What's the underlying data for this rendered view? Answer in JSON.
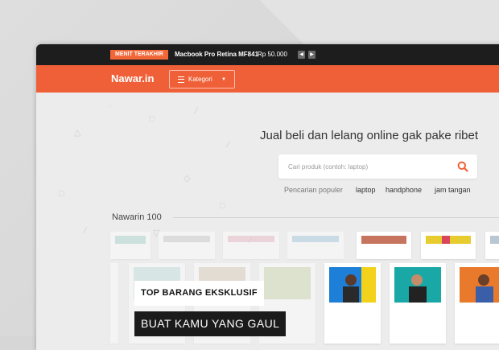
{
  "ticker": {
    "badge": "MENIT TERAKHIR",
    "product": "Macbook Pro Retina MF841",
    "price": "Rp 50.000",
    "prev_icon": "chevron-left-icon",
    "next_icon": "chevron-right-icon"
  },
  "header": {
    "logo": "Nawar.in",
    "category_button": "Kategori",
    "category_icon": "hamburger-icon",
    "dropdown_icon": "caret-down-icon"
  },
  "hero": {
    "tagline": "Jual beli dan lelang online gak pake ribet",
    "search_placeholder": "Cari produk (contoh: laptop)",
    "search_icon": "search-icon",
    "popular_label": "Pencarian populer",
    "popular_terms": [
      "laptop",
      "handphone",
      "jam tangan"
    ]
  },
  "section": {
    "title": "Nawarin 100"
  },
  "overlay": {
    "line1": "TOP BARANG EKSKLUSIF",
    "line2": "BUAT KAMU YANG GAUL"
  },
  "colors": {
    "accent": "#f06038",
    "topbar": "#1d1d1d",
    "background": "#ececec"
  }
}
